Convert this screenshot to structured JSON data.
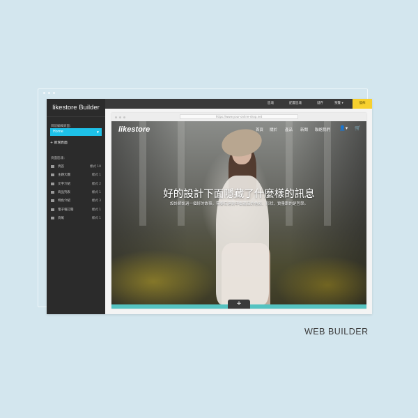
{
  "sidebar": {
    "app_title": "likestore Builder",
    "current_page_label": "目前編輯頁面：",
    "current_page_value": "Home",
    "add_page_label": "新增頁面",
    "layout_label": "頁面區塊：",
    "sections": [
      {
        "name": "頁首",
        "style": "樣式 10"
      },
      {
        "name": "主題大圖",
        "style": "樣式 1"
      },
      {
        "name": "文字介紹",
        "style": "樣式 2"
      },
      {
        "name": "商品列表",
        "style": "樣式 1"
      },
      {
        "name": "特色介紹",
        "style": "樣式 3"
      },
      {
        "name": "電子報訂閱",
        "style": "樣式 1"
      },
      {
        "name": "頁尾",
        "style": "樣式 1"
      }
    ]
  },
  "topbar": {
    "items": [
      "區塊",
      "配置區塊",
      "儲存",
      "預覽"
    ],
    "publish": "發佈"
  },
  "browser": {
    "url": "https://www.your-online-shop.net"
  },
  "site": {
    "logo": "likestore",
    "nav": [
      "首頁",
      "關於",
      "產品",
      "新聞",
      "聯絡我們"
    ],
    "headline": "好的設計下面隱藏了什麼樣的訊息",
    "subheadline": "設計師說過一個好的故事，需要有達到平衡產品的色彩、形狀、質量跟的是哲學。"
  },
  "caption": "WEB BUILDER"
}
